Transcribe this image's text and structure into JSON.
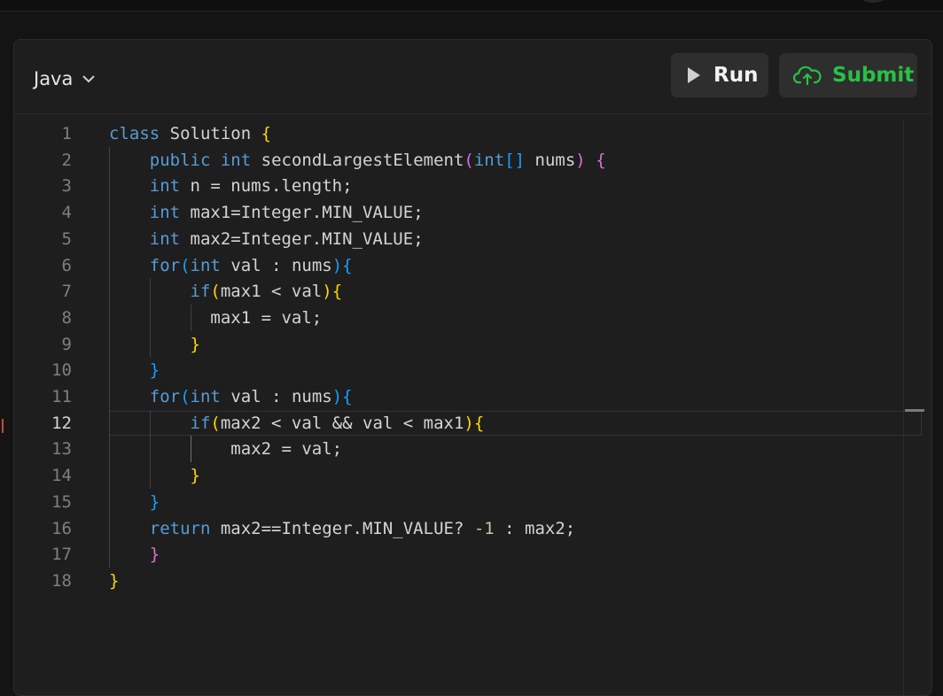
{
  "toolbar": {
    "language": "Java",
    "language_icon": "chevron-down-icon",
    "run_label": "Run",
    "run_icon": "play-icon",
    "submit_label": "Submit",
    "submit_icon": "cloud-upload-icon"
  },
  "colors": {
    "keyword": "#569cd6",
    "bracket_level1": "#ffd700",
    "bracket_level2": "#da70d6",
    "bracket_level3": "#179fff",
    "number": "#b5cea8",
    "submit_green": "#28c244"
  },
  "editor": {
    "active_line": 12,
    "line_numbers": [
      "1",
      "2",
      "3",
      "4",
      "5",
      "6",
      "7",
      "8",
      "9",
      "10",
      "11",
      "12",
      "13",
      "14",
      "15",
      "16",
      "17",
      "18"
    ],
    "lines": [
      [
        {
          "t": "class",
          "c": "kw"
        },
        {
          "t": " Solution ",
          "c": "id"
        },
        {
          "t": "{",
          "c": "b1"
        }
      ],
      [
        {
          "t": "    ",
          "c": "id"
        },
        {
          "t": "public",
          "c": "kw"
        },
        {
          "t": " ",
          "c": "id"
        },
        {
          "t": "int",
          "c": "kw"
        },
        {
          "t": " secondLargestElement",
          "c": "id"
        },
        {
          "t": "(",
          "c": "b2"
        },
        {
          "t": "int",
          "c": "kw"
        },
        {
          "t": "[]",
          "c": "b3"
        },
        {
          "t": " nums",
          "c": "id"
        },
        {
          "t": ")",
          "c": "b2"
        },
        {
          "t": " ",
          "c": "id"
        },
        {
          "t": "{",
          "c": "b2"
        }
      ],
      [
        {
          "t": "    ",
          "c": "id"
        },
        {
          "t": "int",
          "c": "kw"
        },
        {
          "t": " n = nums.length;",
          "c": "id"
        }
      ],
      [
        {
          "t": "    ",
          "c": "id"
        },
        {
          "t": "int",
          "c": "kw"
        },
        {
          "t": " max1=Integer.MIN_VALUE;",
          "c": "id"
        }
      ],
      [
        {
          "t": "    ",
          "c": "id"
        },
        {
          "t": "int",
          "c": "kw"
        },
        {
          "t": " max2=Integer.MIN_VALUE;",
          "c": "id"
        }
      ],
      [
        {
          "t": "    ",
          "c": "id"
        },
        {
          "t": "for",
          "c": "kw"
        },
        {
          "t": "(",
          "c": "b3"
        },
        {
          "t": "int",
          "c": "kw"
        },
        {
          "t": " val : nums",
          "c": "id"
        },
        {
          "t": ")",
          "c": "b3"
        },
        {
          "t": "{",
          "c": "b3"
        }
      ],
      [
        {
          "t": "        ",
          "c": "id"
        },
        {
          "t": "if",
          "c": "kw"
        },
        {
          "t": "(",
          "c": "b1"
        },
        {
          "t": "max1 < val",
          "c": "id"
        },
        {
          "t": ")",
          "c": "b1"
        },
        {
          "t": "{",
          "c": "b1"
        }
      ],
      [
        {
          "t": "          max1 = val;",
          "c": "id"
        }
      ],
      [
        {
          "t": "        ",
          "c": "id"
        },
        {
          "t": "}",
          "c": "b1"
        }
      ],
      [
        {
          "t": "    ",
          "c": "id"
        },
        {
          "t": "}",
          "c": "b3"
        }
      ],
      [
        {
          "t": "    ",
          "c": "id"
        },
        {
          "t": "for",
          "c": "kw"
        },
        {
          "t": "(",
          "c": "b3"
        },
        {
          "t": "int",
          "c": "kw"
        },
        {
          "t": " val : nums",
          "c": "id"
        },
        {
          "t": ")",
          "c": "b3"
        },
        {
          "t": "{",
          "c": "b3"
        }
      ],
      [
        {
          "t": "        ",
          "c": "id"
        },
        {
          "t": "if",
          "c": "kw"
        },
        {
          "t": "(",
          "c": "b1"
        },
        {
          "t": "max2 < val && val < max1",
          "c": "id"
        },
        {
          "t": ")",
          "c": "b1"
        },
        {
          "t": "{",
          "c": "b1"
        }
      ],
      [
        {
          "t": "            max2 = val;",
          "c": "id"
        }
      ],
      [
        {
          "t": "        ",
          "c": "id"
        },
        {
          "t": "}",
          "c": "b1"
        }
      ],
      [
        {
          "t": "    ",
          "c": "id"
        },
        {
          "t": "}",
          "c": "b3"
        }
      ],
      [
        {
          "t": "    ",
          "c": "id"
        },
        {
          "t": "return",
          "c": "kw"
        },
        {
          "t": " max2==Integer.MIN_VALUE? ",
          "c": "id"
        },
        {
          "t": "-1",
          "c": "num"
        },
        {
          "t": " : max2;",
          "c": "id"
        }
      ],
      [
        {
          "t": "    ",
          "c": "id"
        },
        {
          "t": "}",
          "c": "b2"
        }
      ],
      [
        {
          "t": "}",
          "c": "b1"
        }
      ]
    ]
  }
}
